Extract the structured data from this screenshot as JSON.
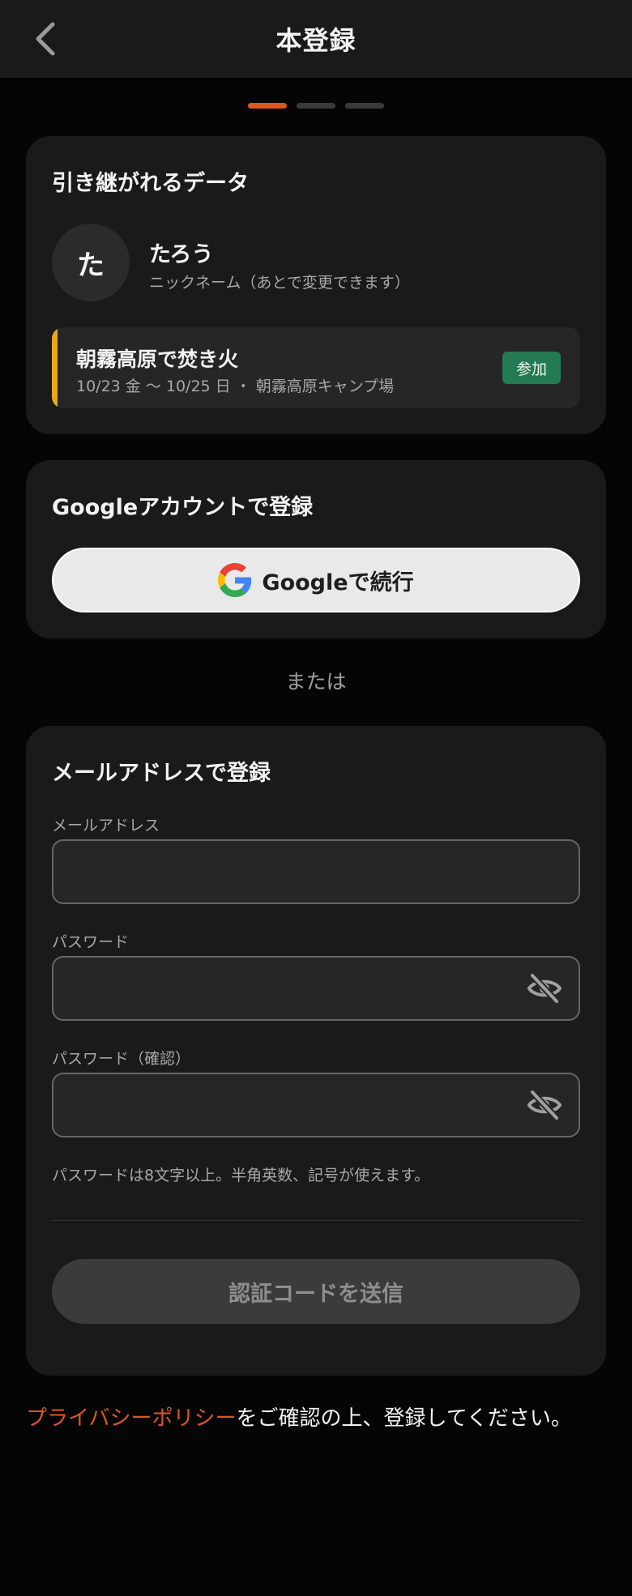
{
  "header": {
    "title": "本登録",
    "back_icon": "chevron-left-icon"
  },
  "steps": {
    "total": 3,
    "current": 1
  },
  "inherit": {
    "title": "引き継がれるデータ",
    "avatar_initial": "た",
    "nickname": "たろう",
    "nickname_note": "ニックネーム（あとで変更できます）",
    "event": {
      "title": "朝霧高原で焚き火",
      "meta": "10/23 金 〜 10/25 日 ・ 朝霧高原キャンプ場",
      "badge": "参加"
    }
  },
  "google": {
    "title": "Googleアカウントで登録",
    "button_label": "Googleで続行",
    "icon": "google-logo-icon"
  },
  "or_text": "または",
  "email": {
    "title": "メールアドレスで登録",
    "email_label": "メールアドレス",
    "email_value": "",
    "password_label": "パスワード",
    "password_value": "",
    "password_confirm_label": "パスワード（確認）",
    "password_confirm_value": "",
    "hint": "パスワードは8文字以上。半角英数、記号が使えます。",
    "submit_label": "認証コードを送信",
    "eye_icon": "eye-off-icon"
  },
  "privacy": {
    "link_text": "プライバシーポリシー",
    "rest_text": "をご確認の上、登録してください。"
  },
  "colors": {
    "accent": "#e0561f",
    "event_bar": "#e8a81c",
    "badge_bg": "#237a55",
    "card_bg": "#1a1a1a"
  }
}
